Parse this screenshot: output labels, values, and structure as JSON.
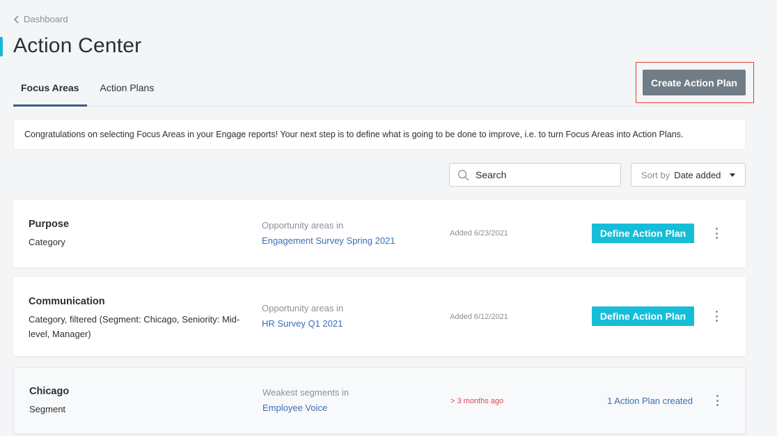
{
  "breadcrumb": {
    "label": "Dashboard"
  },
  "page": {
    "title": "Action Center"
  },
  "tabs": [
    {
      "label": "Focus Areas",
      "active": true
    },
    {
      "label": "Action Plans",
      "active": false
    }
  ],
  "create_button": {
    "label": "Create Action Plan"
  },
  "banner": {
    "text": "Congratulations on selecting Focus Areas in your Engage reports! Your next step is to define what is going to be done to improve, i.e. to turn Focus Areas into Action Plans."
  },
  "search": {
    "placeholder": "Search",
    "icon": "search-icon"
  },
  "sort": {
    "label": "Sort by",
    "value": "Date added",
    "icon": "caret-down-icon"
  },
  "focus_areas": [
    {
      "name": "Purpose",
      "description": "Category",
      "source_label": "Opportunity areas in",
      "source_link": "Engagement Survey Spring 2021",
      "date": "Added 6/23/2021",
      "action_label": "Define Action Plan"
    },
    {
      "name": "Communication",
      "description": "Category, filtered (Segment: Chicago, Seniority: Mid-level, Manager)",
      "source_label": "Opportunity areas in",
      "source_link": "HR Survey Q1 2021",
      "date": "Added 6/12/2021",
      "action_label": "Define Action Plan"
    },
    {
      "name": "Chicago",
      "description": "Segment",
      "source_label": "Weakest segments in",
      "source_link": "Employee Voice",
      "date": "> 3 months ago",
      "plans_created": "1 Action Plan created"
    }
  ],
  "colors": {
    "accent": "#16bdd9",
    "primary_dark": "#3f5a87",
    "link": "#3a6db5",
    "warning": "#e0435a",
    "highlight_border": "#e0432b",
    "create_button_bg": "#717d86"
  }
}
